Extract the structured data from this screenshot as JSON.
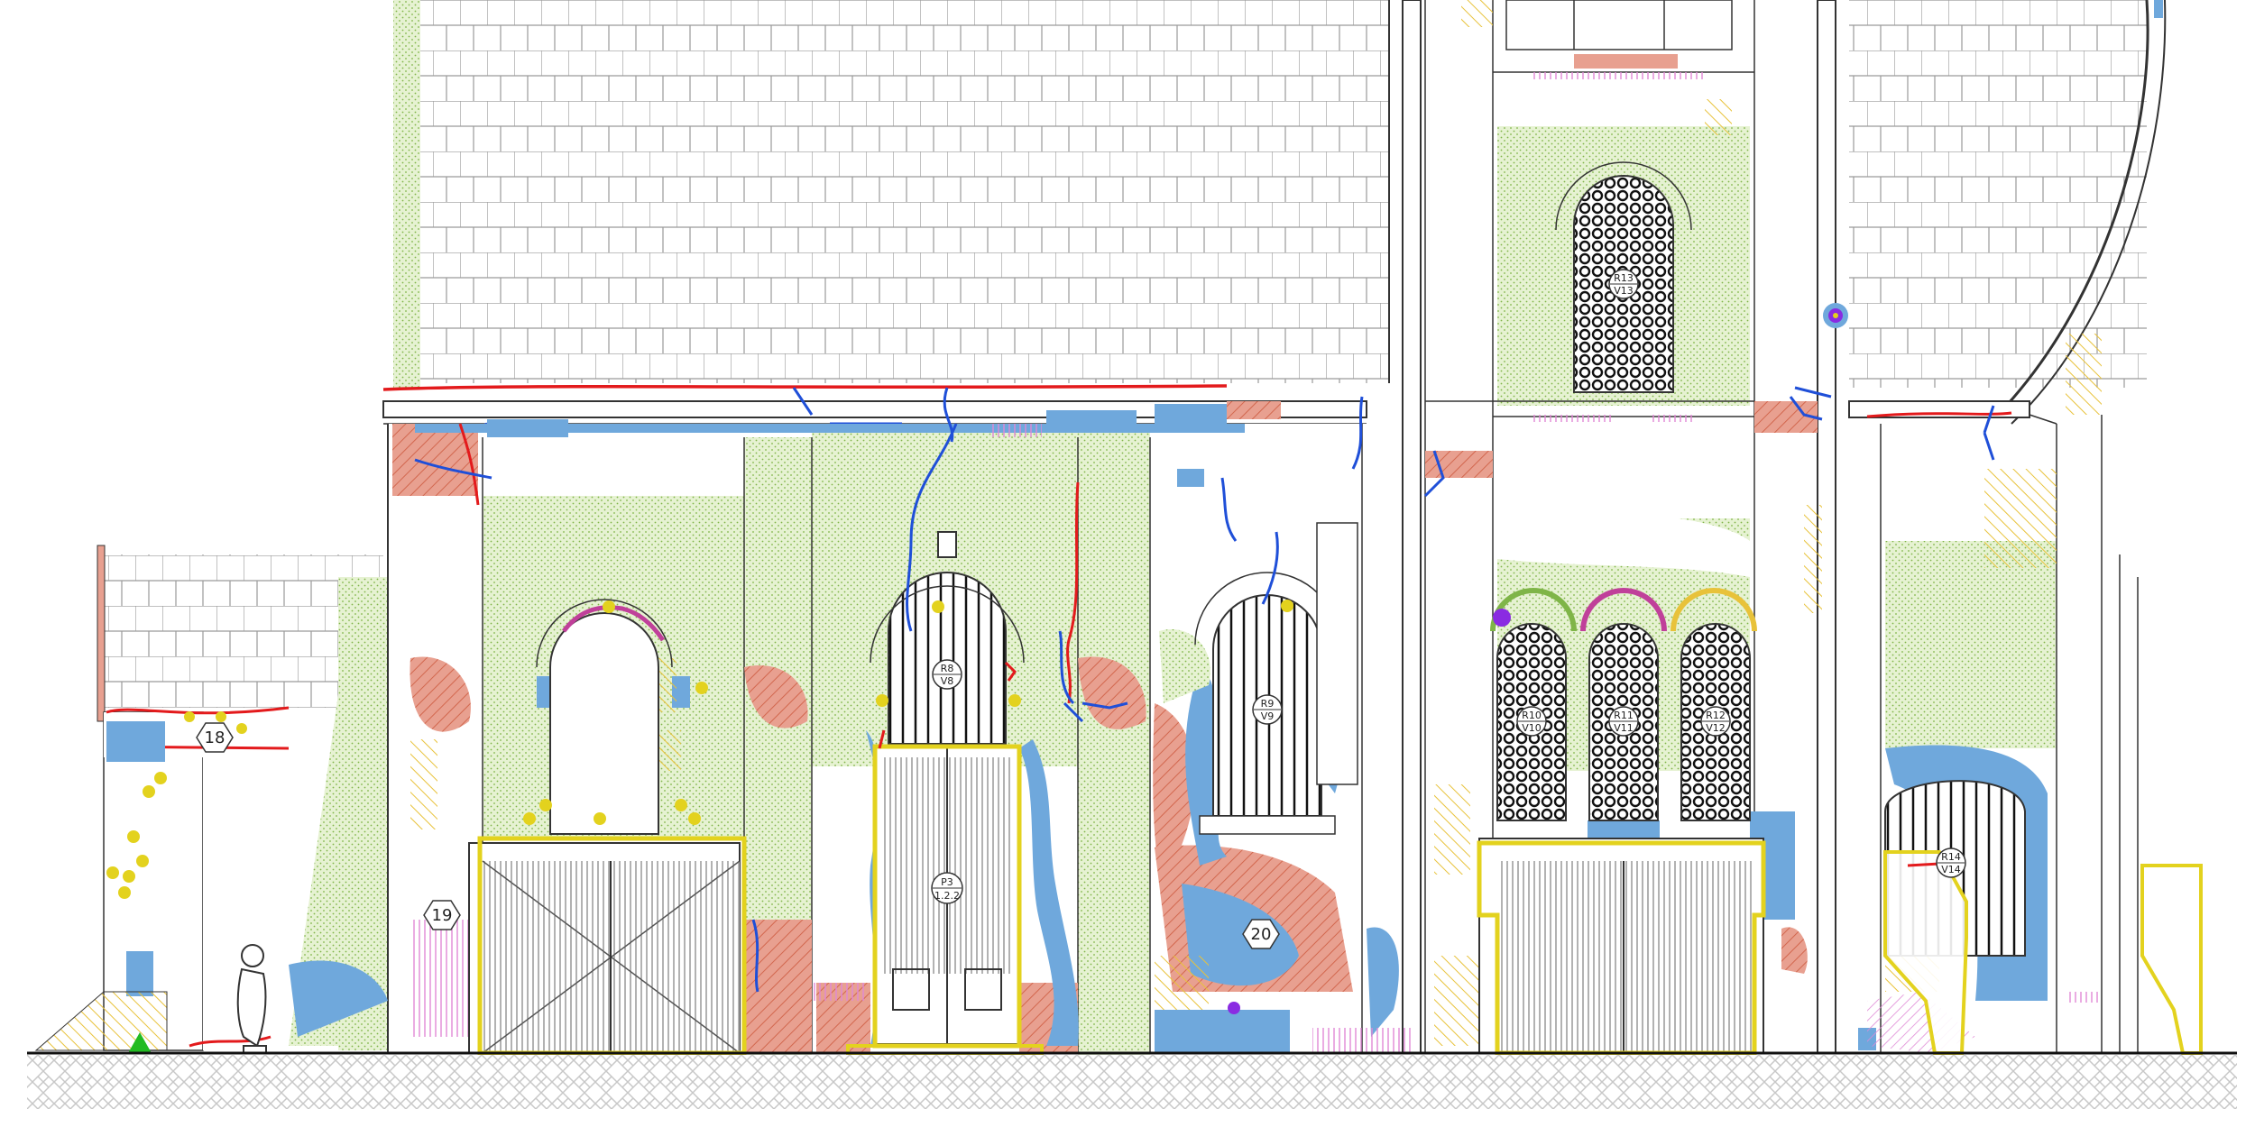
{
  "drawing": {
    "type": "facade-elevation-damage-survey",
    "colors": {
      "moisture_blue": "#6fa8dc",
      "crack_red": "#e31a1c",
      "crack_blue": "#1f4fd8",
      "render_loss_salmon": "#e8a090",
      "biological_green": "#cfe8a9",
      "yellow_outline": "#e3d21e",
      "yellow_marker": "#e3d21e",
      "magenta_hatch": "#e089d6",
      "purple_marker": "#8a2be2",
      "ground_hatch": "#c8c8c8",
      "roof_line": "#9a9a9a",
      "green_marker": "#22bb22"
    },
    "labels": {
      "label_18": "18",
      "label_19": "19",
      "label_20": "20",
      "door_p3": [
        "P3",
        "1.2.2"
      ],
      "window_r8": [
        "R8",
        "V8"
      ],
      "window_r9": [
        "R9",
        "V9"
      ],
      "window_r10": [
        "R10",
        "V10"
      ],
      "window_r11": [
        "R11",
        "V11"
      ],
      "window_r12": [
        "R12",
        "V12"
      ],
      "window_r13": [
        "R13",
        "V13"
      ],
      "window_r14": [
        "R14",
        "V14"
      ]
    }
  }
}
